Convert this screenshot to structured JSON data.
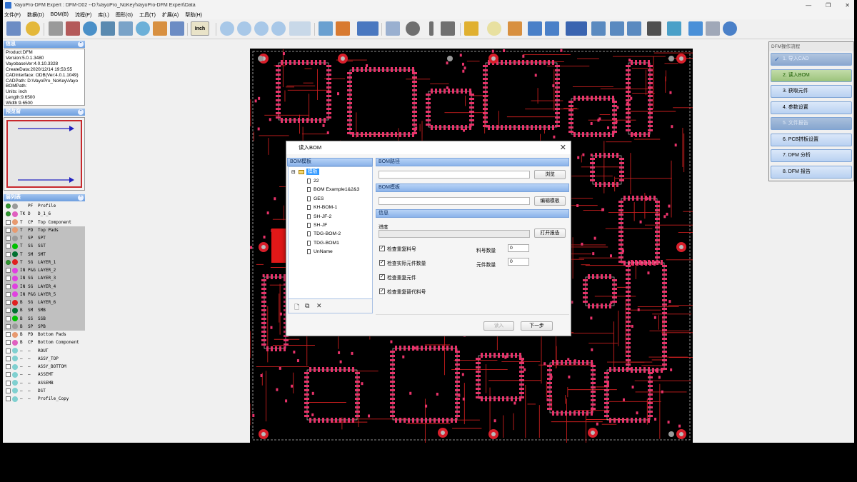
{
  "window": {
    "title": "VayoPro-DFM Expert : DFM-D02  --D:\\VayoPro_NoKey\\VayoPro-DFM Expert\\Data",
    "minimize": "—",
    "restore": "❐",
    "close": "✕"
  },
  "menu": [
    "文件(F)",
    "数据(D)",
    "BOM(B)",
    "流程(P)",
    "库(L)",
    "图形(G)",
    "工具(T)",
    "扩展(A)",
    "帮助(H)"
  ],
  "toolbar": {
    "unit_label": "Inch"
  },
  "panels": {
    "info_title": "信息",
    "preview_title": "预览窗",
    "layers_title": "层列表",
    "collapse_glyph": "⌃"
  },
  "info_lines": [
    "Product:DFM",
    "Version:5.0.1.3480",
    "VayobaseVer:4.0.10.3328",
    "CreateData:2020/12/14 19:53:55",
    "CADInterface: ODB(Ver:4.0.1.1049)",
    "CADPath: D:\\VayoPro_NoKey\\Vayo",
    "BOMPath:",
    "Units: inch",
    "Length:9.6500",
    "Width:9.6500"
  ],
  "layers": [
    {
      "on": true,
      "color": "#9a9a9a",
      "c1": "",
      "c2": "PF",
      "name": "Profile",
      "sel": false
    },
    {
      "on": true,
      "color": "#e060c0",
      "c1": "TK",
      "c2": "D",
      "name": "D_1_6",
      "sel": false
    },
    {
      "on": false,
      "color": "#e89a70",
      "c1": "T",
      "c2": "CP",
      "name": "Top Component",
      "sel": false
    },
    {
      "on": false,
      "color": "#e89a70",
      "c1": "T",
      "c2": "PD",
      "name": "Top Pads",
      "sel": true
    },
    {
      "on": false,
      "color": "#9a9a9a",
      "c1": "T",
      "c2": "SP",
      "name": "SPT",
      "sel": true
    },
    {
      "on": false,
      "color": "#00c000",
      "c1": "T",
      "c2": "SS",
      "name": "SST",
      "sel": true
    },
    {
      "on": false,
      "color": "#007030",
      "c1": "T",
      "c2": "SM",
      "name": "SMT",
      "sel": true
    },
    {
      "on": true,
      "color": "#e02020",
      "c1": "T",
      "c2": "SG",
      "name": "LAYER_1",
      "sel": true
    },
    {
      "on": false,
      "color": "#e040e0",
      "c1": "IN",
      "c2": "P&G",
      "name": "LAYER_2",
      "sel": true
    },
    {
      "on": false,
      "color": "#e040e0",
      "c1": "IN",
      "c2": "SG",
      "name": "LAYER_3",
      "sel": true
    },
    {
      "on": false,
      "color": "#e040e0",
      "c1": "IN",
      "c2": "SG",
      "name": "LAYER_4",
      "sel": true
    },
    {
      "on": false,
      "color": "#e040e0",
      "c1": "IN",
      "c2": "P&G",
      "name": "LAYER_5",
      "sel": true
    },
    {
      "on": false,
      "color": "#e02020",
      "c1": "B",
      "c2": "SG",
      "name": "LAYER_6",
      "sel": true
    },
    {
      "on": false,
      "color": "#007030",
      "c1": "B",
      "c2": "SM",
      "name": "SMB",
      "sel": true
    },
    {
      "on": false,
      "color": "#00c000",
      "c1": "B",
      "c2": "SS",
      "name": "SSB",
      "sel": true
    },
    {
      "on": false,
      "color": "#9a9a9a",
      "c1": "B",
      "c2": "SP",
      "name": "SPB",
      "sel": true
    },
    {
      "on": false,
      "color": "#e89a70",
      "c1": "B",
      "c2": "PD",
      "name": "Bottom Pads",
      "sel": false
    },
    {
      "on": false,
      "color": "#e060c0",
      "c1": "B",
      "c2": "CP",
      "name": "Bottom Component",
      "sel": false
    },
    {
      "on": false,
      "color": "#80d0d0",
      "c1": "—",
      "c2": "—",
      "name": "ROUT",
      "sel": false
    },
    {
      "on": false,
      "color": "#80d0d0",
      "c1": "—",
      "c2": "—",
      "name": "ASSY_TOP",
      "sel": false
    },
    {
      "on": false,
      "color": "#80d0d0",
      "c1": "—",
      "c2": "—",
      "name": "ASSY_BOTTOM",
      "sel": false
    },
    {
      "on": false,
      "color": "#80d0d0",
      "c1": "—",
      "c2": "—",
      "name": "ASSEMT",
      "sel": false
    },
    {
      "on": false,
      "color": "#80d0d0",
      "c1": "—",
      "c2": "—",
      "name": "ASSEMB",
      "sel": false
    },
    {
      "on": false,
      "color": "#80d0d0",
      "c1": "—",
      "c2": "—",
      "name": "DST",
      "sel": false
    },
    {
      "on": false,
      "color": "#80d0d0",
      "c1": "—",
      "c2": "—",
      "name": "Profile_Copy",
      "sel": false
    }
  ],
  "flow": {
    "title": "DFM操作流程",
    "steps": [
      {
        "label": "1. 导入CAD",
        "state": "done"
      },
      {
        "label": "2. 读入BOM",
        "state": "current"
      },
      {
        "label": "3. 获取元件",
        "state": "normal"
      },
      {
        "label": "4. 参数设置",
        "state": "normal"
      },
      {
        "label": "5. 文件报告",
        "state": "disabled"
      },
      {
        "label": "6. PCB拼板设置",
        "state": "normal"
      },
      {
        "label": "7. DFM 分析",
        "state": "normal"
      },
      {
        "label": "8. DFM 报告",
        "state": "normal"
      }
    ],
    "check_glyph": "✓"
  },
  "dialog": {
    "title": "读入BOM",
    "close": "✕",
    "template_section": "BOM模板",
    "tree_root": "模板",
    "tree_items": [
      "22",
      "BOM Example1&2&3",
      "GES",
      "KH-BOM-1",
      "SH-JF-2",
      "SH-JF",
      "TDG-BOM-2",
      "TDG-BOM1",
      "UnName"
    ],
    "tree_expand": "⊟",
    "tree_footer": {
      "new": "🗋",
      "copy": "⧉",
      "delete": "✕"
    },
    "path_section": "BOM路径",
    "browse_button": "浏览",
    "template_section2": "BOM模板",
    "edit_template_button": "编辑模板",
    "info_section": "信息",
    "progress_label": "进度",
    "open_report_button": "打开报告",
    "checks": [
      {
        "label": "检查重复料号",
        "checked": true
      },
      {
        "label": "检查实际元件数量",
        "checked": true
      },
      {
        "label": "检查重复元件",
        "checked": true
      },
      {
        "label": "检查重复替代料号",
        "checked": true
      }
    ],
    "part_count_label": "料号数量",
    "part_count_value": "0",
    "comp_count_label": "元件数量",
    "comp_count_value": "0",
    "import_button": "读入",
    "next_button": "下一步",
    "check_mark": "✓"
  }
}
